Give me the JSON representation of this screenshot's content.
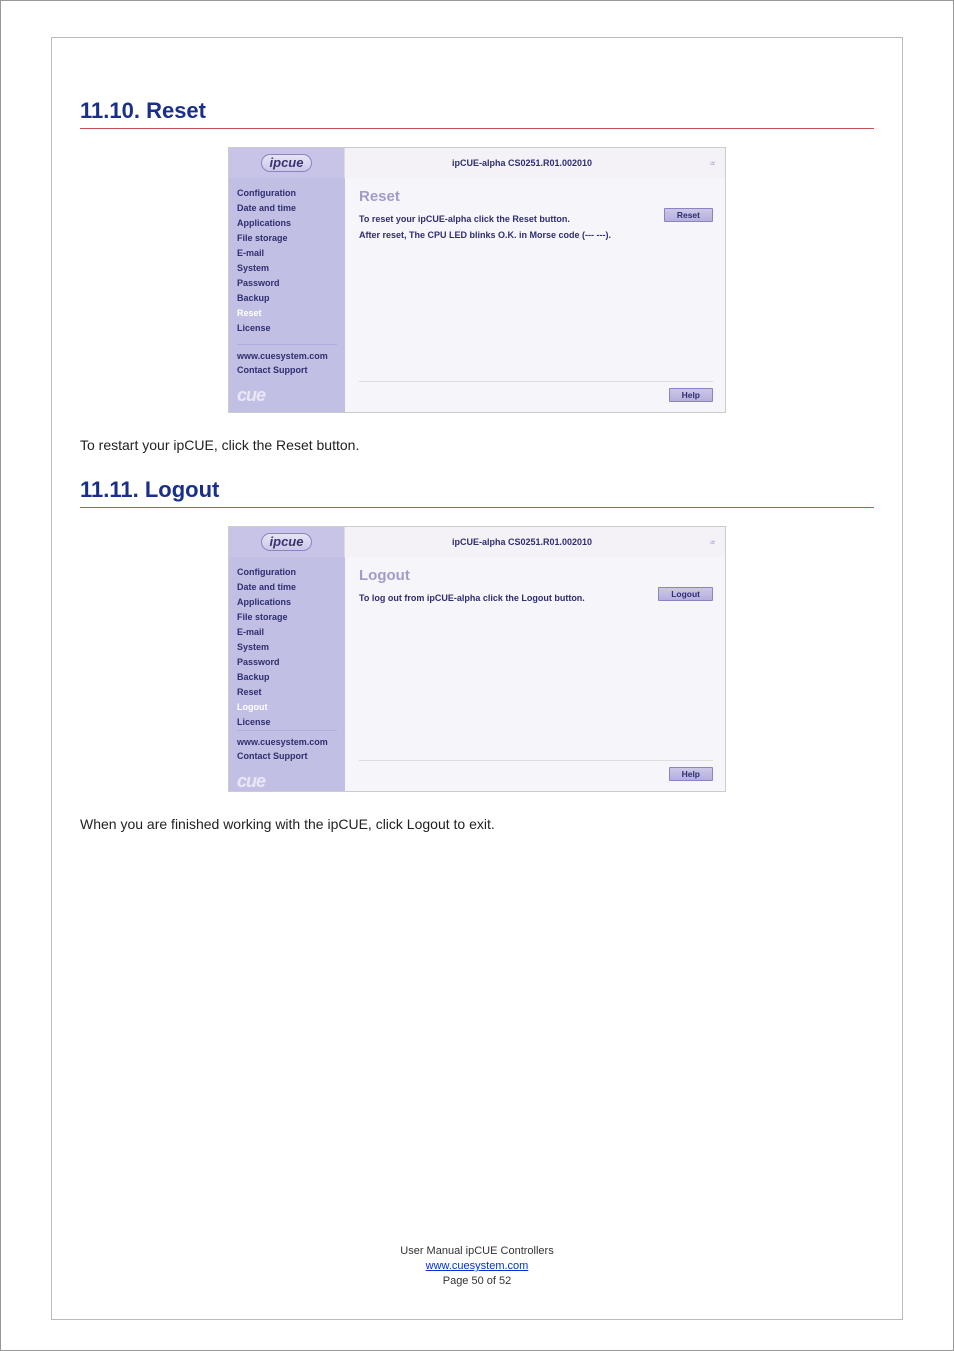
{
  "headings": {
    "reset": "11.10.  Reset",
    "logout": "11.11.  Logout"
  },
  "body_text": {
    "after_reset": "To restart your ipCUE, click the Reset button.",
    "after_logout": "When you are finished working with the ipCUE, click Logout to exit."
  },
  "footer": {
    "line1": "User Manual ipCUE Controllers",
    "link": "www.cuesystem.com",
    "line3": "Page 50 of 52"
  },
  "common": {
    "logo": "ipcue",
    "title": "ipCUE-alpha  CS0251.R01.002010",
    "brand": "cue",
    "site_link": "www.cuesystem.com",
    "contact": "Contact Support",
    "help": "Help"
  },
  "sidebar_reset": {
    "items": [
      {
        "label": "Configuration",
        "active": false
      },
      {
        "label": "Date and time",
        "active": false
      },
      {
        "label": "Applications",
        "active": false
      },
      {
        "label": "File storage",
        "active": false
      },
      {
        "label": "E-mail",
        "active": false
      },
      {
        "label": "System",
        "active": false
      },
      {
        "label": "Password",
        "active": false
      },
      {
        "label": "Backup",
        "active": false
      },
      {
        "label": "Reset",
        "active": true
      },
      {
        "label": "License",
        "active": false
      }
    ]
  },
  "sidebar_logout": {
    "items": [
      {
        "label": "Configuration",
        "active": false
      },
      {
        "label": "Date and time",
        "active": false
      },
      {
        "label": "Applications",
        "active": false
      },
      {
        "label": "File storage",
        "active": false
      },
      {
        "label": "E-mail",
        "active": false
      },
      {
        "label": "System",
        "active": false
      },
      {
        "label": "Password",
        "active": false
      },
      {
        "label": "Backup",
        "active": false
      },
      {
        "label": "Reset",
        "active": false
      },
      {
        "label": "Logout",
        "active": true
      },
      {
        "label": "License",
        "active": false
      }
    ]
  },
  "panel_reset": {
    "heading": "Reset",
    "line1": "To reset your ipCUE-alpha click the Reset button.",
    "line2": "After reset, The CPU LED blinks O.K. in Morse code (---   ---).",
    "button": "Reset"
  },
  "panel_logout": {
    "heading": "Logout",
    "line1": "To log out from ipCUE-alpha click the Logout button.",
    "button": "Logout"
  }
}
